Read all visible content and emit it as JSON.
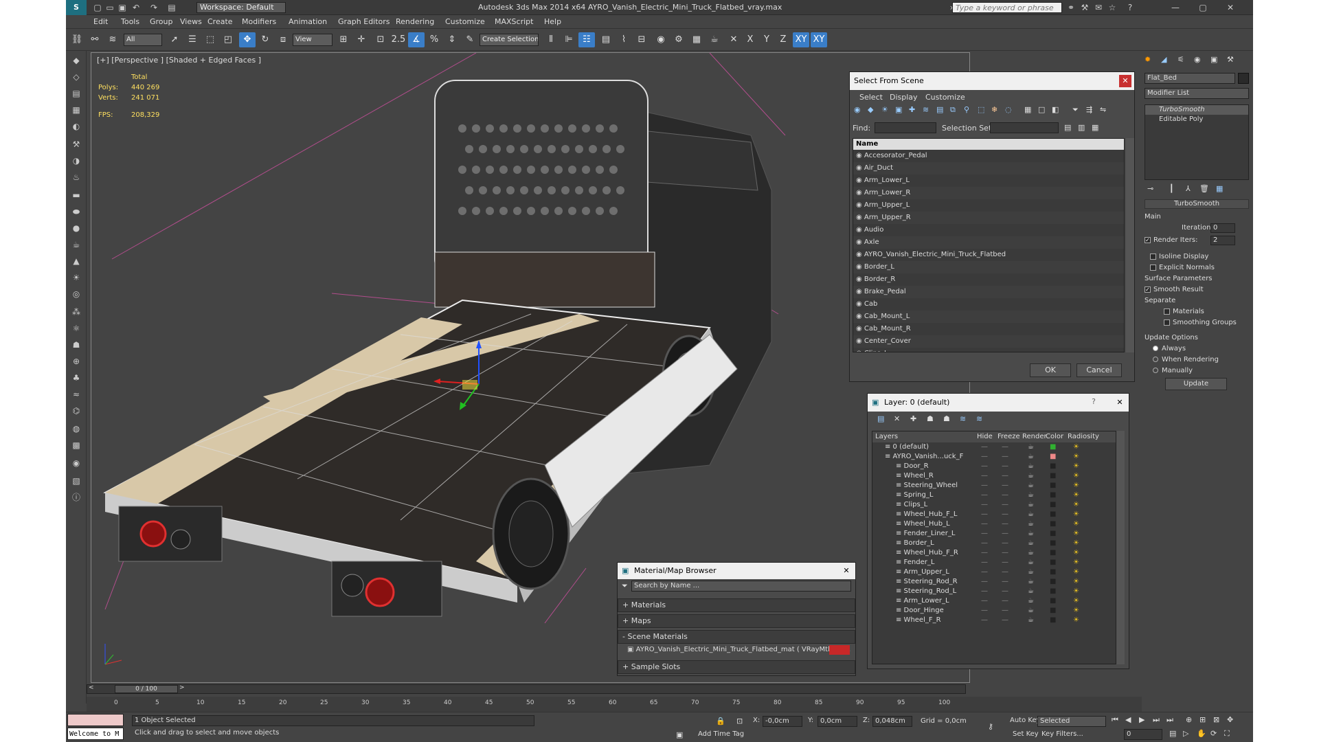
{
  "title_bar": {
    "workspace": "Workspace: Default",
    "title": "Autodesk 3ds Max  2014 x64      AYRO_Vanish_Electric_Mini_Truck_Flatbed_vray.max",
    "search_placeholder": "Type a keyword or phrase"
  },
  "menu": [
    "Edit",
    "Tools",
    "Group",
    "Views",
    "Create",
    "Modifiers",
    "Animation",
    "Graph Editors",
    "Rendering",
    "Customize",
    "MAXScript",
    "Help"
  ],
  "toolbar": {
    "filter": "All",
    "ref_coord": "View",
    "snap_angle": "2.5",
    "selection_set": "Create Selection Se",
    "axes": [
      "X",
      "Y",
      "Z",
      "XY",
      "XY"
    ]
  },
  "viewport": {
    "label": "[+] [Perspective ] [Shaded + Edged Faces ]",
    "stats": {
      "total_label": "Total",
      "polys_label": "Polys:",
      "polys": "440 269",
      "verts_label": "Verts:",
      "verts": "241 071",
      "fps_label": "FPS:",
      "fps": "208,329"
    }
  },
  "select_from_scene": {
    "title": "Select From Scene",
    "tabs": [
      "Select",
      "Display",
      "Customize"
    ],
    "find_label": "Find:",
    "selection_set_label": "Selection Set:",
    "column": "Name",
    "items": [
      "Accesorator_Pedal",
      "Air_Duct",
      "Arm_Lower_L",
      "Arm_Lower_R",
      "Arm_Upper_L",
      "Arm_Upper_R",
      "Audio",
      "Axle",
      "AYRO_Vanish_Electric_Mini_Truck_Flatbed",
      "Border_L",
      "Border_R",
      "Brake_Pedal",
      "Cab",
      "Cab_Mount_L",
      "Cab_Mount_R",
      "Center_Cover",
      "Clips_L"
    ],
    "ok": "OK",
    "cancel": "Cancel"
  },
  "layer_dialog": {
    "title": "Layer: 0 (default)",
    "columns": [
      "Layers",
      "Hide",
      "Freeze",
      "Render",
      "Color",
      "Radiosity"
    ],
    "rows": [
      "0 (default)",
      "AYRO_Vanish...uck_F",
      "Door_R",
      "Wheel_R",
      "Steering_Wheel",
      "Spring_L",
      "Clips_L",
      "Wheel_Hub_F_L",
      "Wheel_Hub_L",
      "Fender_Liner_L",
      "Border_L",
      "Wheel_Hub_F_R",
      "Fender_L",
      "Arm_Upper_L",
      "Steering_Rod_R",
      "Steering_Rod_L",
      "Arm_Lower_L",
      "Door_Hinge",
      "Wheel_F_R"
    ]
  },
  "material_browser": {
    "title": "Material/Map Browser",
    "search_placeholder": "Search by Name ...",
    "sections": [
      "+ Materials",
      "+ Maps",
      "- Scene Materials",
      "+ Sample Slots"
    ],
    "scene_material": "AYRO_Vanish_Electric_Mini_Truck_Flatbed_mat  ( VRayMtl ) [A..."
  },
  "command_panel": {
    "object_name": "Flat_Bed",
    "modifier_list": "Modifier List",
    "stack": [
      "TurboSmooth",
      "Editable Poly"
    ],
    "rollout_title": "TurboSmooth",
    "main_label": "Main",
    "iterations_label": "Iterations:",
    "iterations": "0",
    "render_iters_label": "Render Iters:",
    "render_iters": "2",
    "isoline": "Isoline Display",
    "explicit": "Explicit Normals",
    "surface_params": "Surface Parameters",
    "smooth_result": "Smooth Result",
    "separate": "Separate",
    "materials": "Materials",
    "smoothing_groups": "Smoothing Groups",
    "update_options": "Update Options",
    "always": "Always",
    "when_rendering": "When Rendering",
    "manually": "Manually",
    "update": "Update"
  },
  "timeline": {
    "frame": "0 / 100",
    "ticks": [
      "0",
      "5",
      "10",
      "15",
      "20",
      "25",
      "30",
      "35",
      "40",
      "45",
      "50",
      "55",
      "60",
      "65",
      "70",
      "75",
      "80",
      "85",
      "90",
      "95",
      "100"
    ]
  },
  "status": {
    "welcome": "Welcome to M",
    "selected": "1 Object Selected",
    "prompt": "Click and drag to select and move objects",
    "x_label": "X:",
    "x": "-0,0cm",
    "y_label": "Y:",
    "y": "0,0cm",
    "z_label": "Z:",
    "z": "0,048cm",
    "grid": "Grid = 0,0cm",
    "add_time_tag": "Add Time Tag",
    "auto_key": "Auto Key",
    "set_key": "Set Key",
    "selected_dd": "Selected",
    "key_filters": "Key Filters...",
    "frame_field": "0"
  }
}
